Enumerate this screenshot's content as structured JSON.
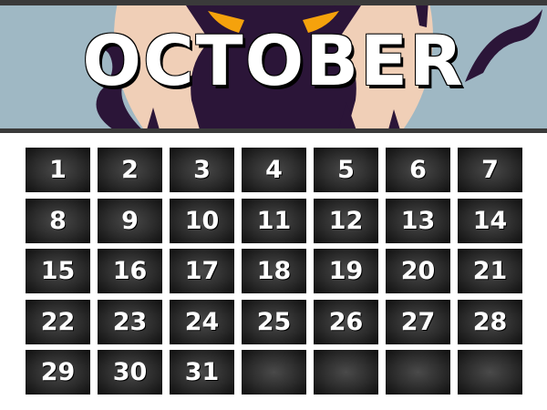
{
  "header": {
    "title": "OCTOBER"
  },
  "calendar": {
    "days": [
      "1",
      "2",
      "3",
      "4",
      "5",
      "6",
      "7",
      "8",
      "9",
      "10",
      "11",
      "12",
      "13",
      "14",
      "15",
      "16",
      "17",
      "18",
      "19",
      "20",
      "21",
      "22",
      "23",
      "24",
      "25",
      "26",
      "27",
      "28",
      "29",
      "30",
      "31",
      "",
      "",
      "",
      ""
    ]
  },
  "colors": {
    "banner_sky": "#9fb8c4",
    "moon": "#f0cfb7",
    "creature": "#2b1538",
    "eyes": "#f5a20c",
    "cell_dark": "#1a1a1a"
  }
}
